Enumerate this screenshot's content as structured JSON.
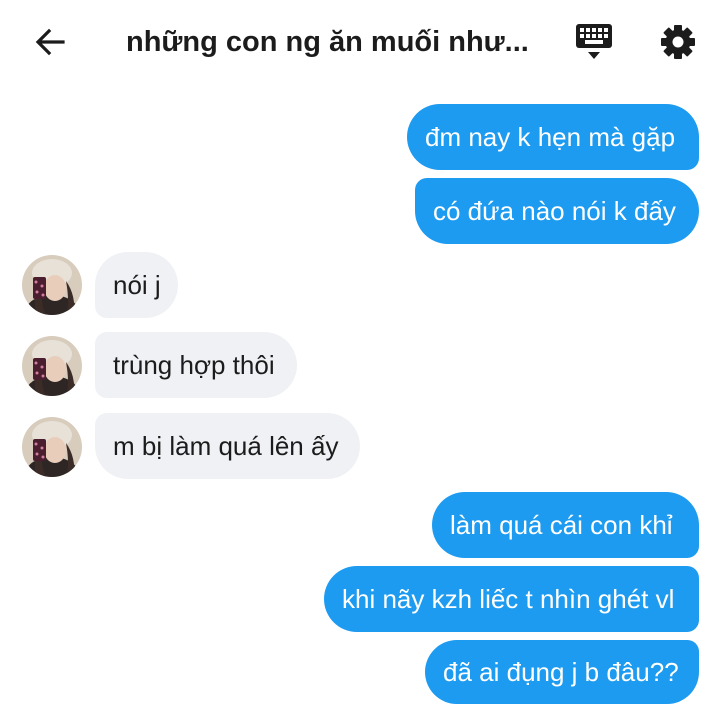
{
  "header": {
    "back_icon": "arrow-left-icon",
    "title": "những con ng ăn muối như...",
    "keyboard_icon": "keyboard-icon",
    "settings_icon": "gear-icon"
  },
  "messages": [
    {
      "side": "out",
      "text": "đm nay k hẹn mà gặp"
    },
    {
      "side": "out",
      "text": "có đứa nào nói k đấy"
    },
    {
      "side": "in",
      "text": "nói j"
    },
    {
      "side": "in",
      "text": "trùng hợp thôi"
    },
    {
      "side": "in",
      "text": "m bị làm quá lên ấy"
    },
    {
      "side": "out",
      "text": "làm quá cái con khỉ"
    },
    {
      "side": "out",
      "text": "khi nãy kzh liếc t nhìn ghét vl"
    },
    {
      "side": "out",
      "text": "đã ai đụng j b đâu??"
    }
  ],
  "colors": {
    "outgoing_bubble": "#1d9bf0",
    "incoming_bubble": "#eff1f4"
  }
}
